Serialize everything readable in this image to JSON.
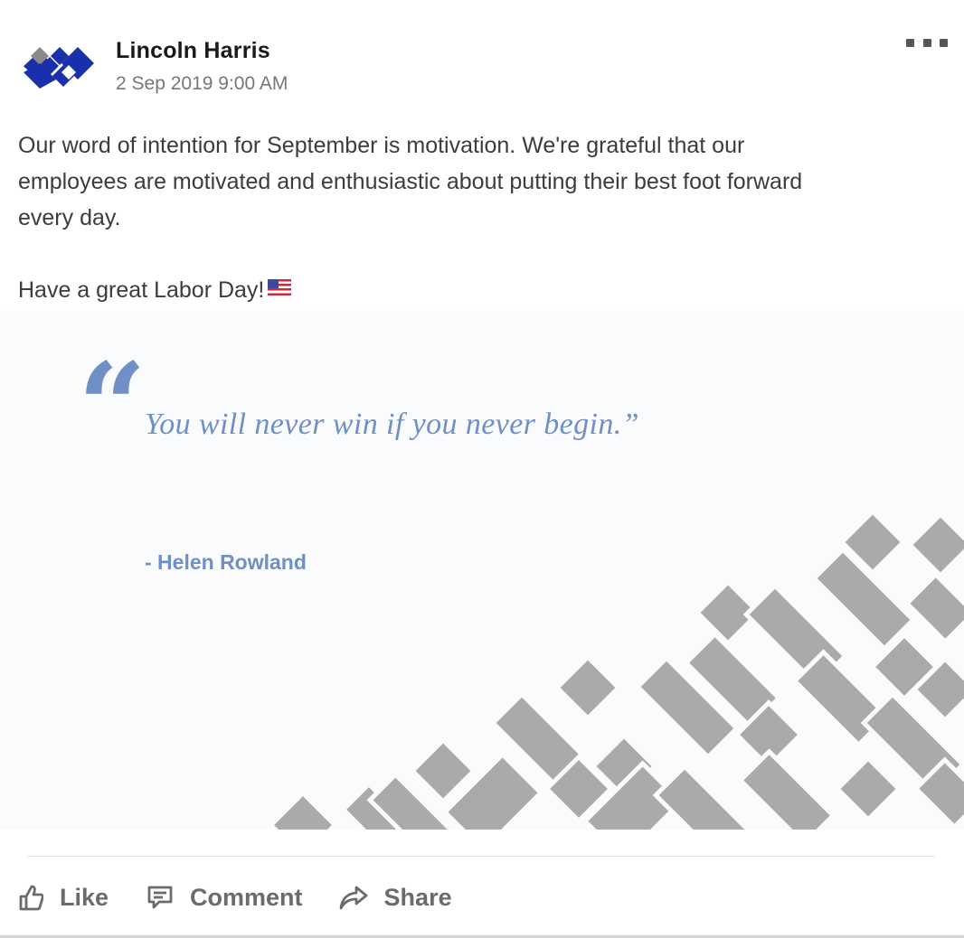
{
  "post": {
    "author": "Lincoln Harris",
    "timestamp": "2 Sep 2019 9:00 AM",
    "avatar_icon": "lincoln-harris-logo",
    "menu_icon": "more-options-icon",
    "body_lines": [
      "Our word of intention for September is motivation. We're grateful that our",
      "employees are motivated and enthusiastic about putting their best foot forward",
      "every day."
    ],
    "closing_line": "Have a great Labor Day!",
    "closing_emoji_icon": "us-flag-icon"
  },
  "image": {
    "quote_mark": "“",
    "quote": "You will never win if you never begin.”",
    "attribution": "- Helen Rowland",
    "colors": {
      "quote": "#6f8fc6",
      "pattern": "#aaaaaa",
      "background": "#fafbfd"
    }
  },
  "actions": [
    {
      "label": "Like",
      "icon": "thumbs-up-icon"
    },
    {
      "label": "Comment",
      "icon": "comment-icon"
    },
    {
      "label": "Share",
      "icon": "share-arrow-icon"
    }
  ],
  "colors": {
    "avatar_blue": "#1a2faa",
    "avatar_gray": "#8a8a8a"
  }
}
